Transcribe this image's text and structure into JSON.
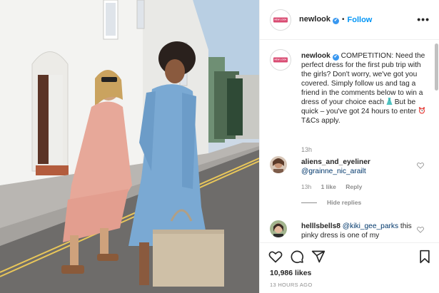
{
  "post": {
    "username": "newlook",
    "verified_mark": "✔",
    "separator": "•",
    "follow_label": "Follow",
    "more_label": "•••",
    "logo_text": "NEW LOOK"
  },
  "caption": {
    "username": "newlook",
    "text_1": " COMPETITION: Need the perfect dress for the first pub trip with the girls? Don't worry, we've got you covered. Simply follow us and tag a friend in the comments below to win a dress of your choice each ",
    "text_2": " But be quick – you've got 24 hours to enter ",
    "text_3": " T&Cs apply.",
    "emoji_1": "dress-emoji",
    "emoji_2": "alarm-clock-emoji",
    "time": "13h"
  },
  "comments": [
    {
      "username": "aliens_and_eyeliner",
      "mention": "@grainne_nic_arailt",
      "text": "",
      "time": "13h",
      "likes": "1 like",
      "reply_label": "Reply",
      "hide_replies_label": "Hide replies"
    },
    {
      "username": "helllsbells8",
      "mention": "@kiki_gee_parks",
      "text": " this pinky dress is one of my"
    }
  ],
  "actions": {
    "icons": [
      "heart-icon",
      "comment-icon",
      "share-icon",
      "bookmark-icon"
    ],
    "likes": "10,986 likes",
    "posted_ago": "13 HOURS AGO"
  },
  "colors": {
    "accent_blue": "#0095f6",
    "verified_blue": "#3897f0",
    "brand_pink": "#d94b72",
    "mention_blue": "#00376b",
    "muted_gray": "#8e8e8e"
  }
}
